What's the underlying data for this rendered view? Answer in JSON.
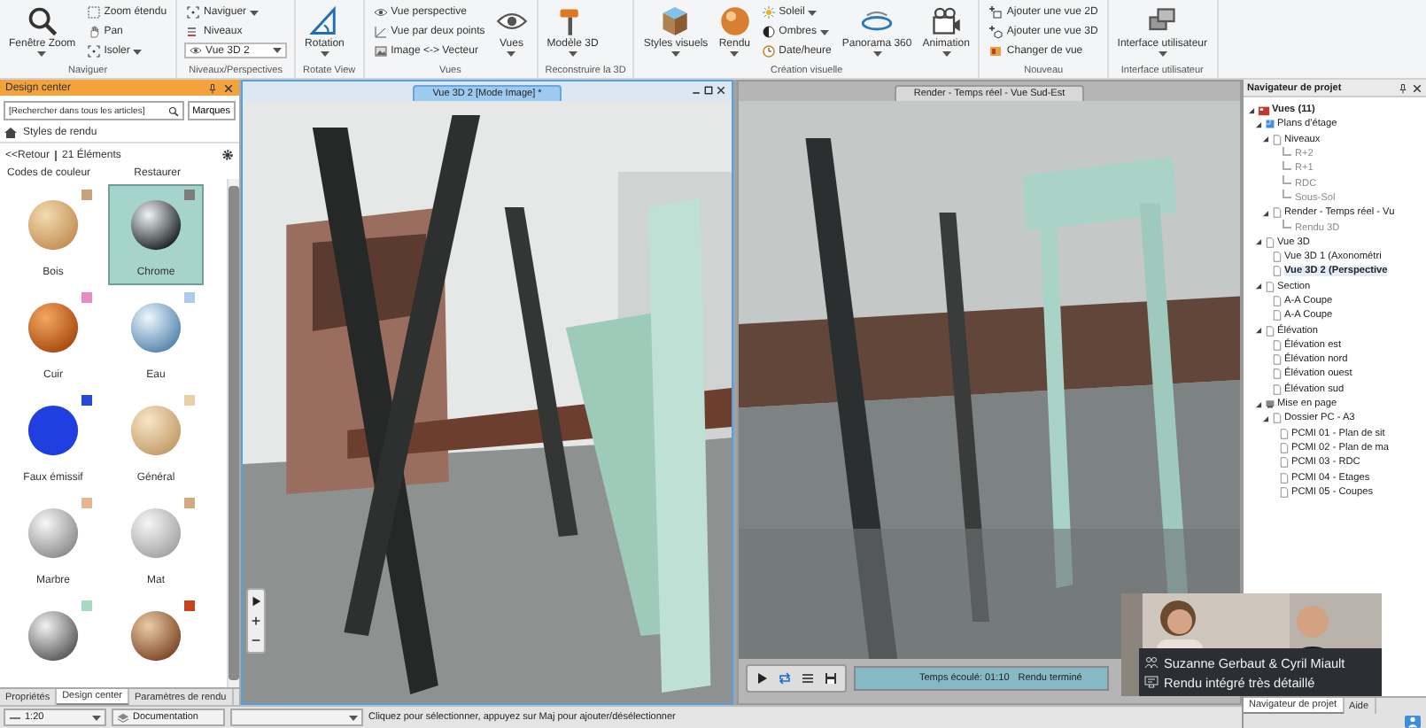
{
  "ribbon": {
    "groups": [
      {
        "label": "Naviguer",
        "columns": [
          {
            "kind": "large",
            "label": "Fenêtre Zoom",
            "dropdown": true
          },
          {
            "kind": "stack",
            "items": [
              {
                "kind": "button",
                "label": "Zoom étendu",
                "dropdown": false
              },
              {
                "kind": "button",
                "label": "Pan",
                "dropdown": false
              },
              {
                "kind": "button",
                "label": "Isoler",
                "dropdown": true
              }
            ]
          }
        ]
      },
      {
        "label": "Niveaux/Perspectives",
        "columns": [
          {
            "kind": "stack",
            "items": [
              {
                "kind": "button",
                "label": "Naviguer",
                "dropdown": true
              },
              {
                "kind": "button",
                "label": "Niveaux",
                "dropdown": false
              },
              {
                "kind": "combo",
                "value": "Vue 3D 2"
              }
            ]
          }
        ]
      },
      {
        "label": "Rotate View",
        "columns": [
          {
            "kind": "large",
            "label": "Rotation",
            "dropdown": true
          }
        ]
      },
      {
        "label": "Vues",
        "columns": [
          {
            "kind": "stack",
            "items": [
              {
                "kind": "button",
                "label": "Vue perspective",
                "dropdown": false
              },
              {
                "kind": "button",
                "label": "Vue par deux points",
                "dropdown": false
              },
              {
                "kind": "button",
                "label": "Image <-> Vecteur",
                "dropdown": false
              }
            ]
          },
          {
            "kind": "large",
            "label": "Vues",
            "dropdown": true
          }
        ]
      },
      {
        "label": "Reconstruire la 3D",
        "columns": [
          {
            "kind": "large",
            "label": "Modèle 3D",
            "dropdown": true
          }
        ]
      },
      {
        "label": "Création visuelle",
        "columns": [
          {
            "kind": "large",
            "label": "Styles visuels",
            "dropdown": true
          },
          {
            "kind": "large",
            "label": "Rendu",
            "dropdown": true
          },
          {
            "kind": "stack",
            "items": [
              {
                "kind": "button",
                "label": "Soleil",
                "dropdown": true
              },
              {
                "kind": "button",
                "label": "Ombres",
                "dropdown": true
              },
              {
                "kind": "button",
                "label": "Date/heure",
                "dropdown": false
              }
            ]
          },
          {
            "kind": "large",
            "label": "Panorama 360",
            "dropdown": true
          },
          {
            "kind": "large",
            "label": "Animation",
            "dropdown": true
          }
        ]
      },
      {
        "label": "Nouveau",
        "columns": [
          {
            "kind": "stack",
            "items": [
              {
                "kind": "button",
                "label": "Ajouter une vue 2D",
                "dropdown": false
              },
              {
                "kind": "button",
                "label": "Ajouter une vue 3D",
                "dropdown": false
              },
              {
                "kind": "button",
                "label": "Changer de vue",
                "dropdown": false
              }
            ]
          }
        ]
      },
      {
        "label": "Interface utilisateur",
        "columns": [
          {
            "kind": "large",
            "label": "Interface utilisateur",
            "dropdown": true
          }
        ]
      }
    ]
  },
  "design_center": {
    "title": "Design center",
    "search": {
      "placeholder": "[Rechercher dans tous les articles]"
    },
    "tags_button": "Marques",
    "breadcrumb": "Styles de rendu",
    "back_link": "<<Retour",
    "count": "21 Éléments",
    "color_codes": "Codes de couleur",
    "restore": "Restaurer",
    "materials": [
      {
        "label": "Bois",
        "kind": "wood",
        "color": "#c9a17a",
        "selected": false
      },
      {
        "label": "Chrome",
        "kind": "chrome",
        "color": "#7d7d7d",
        "selected": true
      },
      {
        "label": "Cuir",
        "kind": "leather",
        "color": "#e58cc4",
        "selected": false
      },
      {
        "label": "Eau",
        "kind": "water",
        "color": "#a9cdea",
        "selected": false
      },
      {
        "label": "Faux émissif",
        "kind": "emissive",
        "color": "#2448d8",
        "selected": false
      },
      {
        "label": "Général",
        "kind": "plain",
        "color": "#e9cfa6",
        "selected": false
      },
      {
        "label": "Marbre",
        "kind": "marble",
        "color": "#e6b78f",
        "selected": false
      },
      {
        "label": "Mat",
        "kind": "matte",
        "color": "#d2aa7c",
        "selected": false
      },
      {
        "kind": "tile",
        "color": "#a6d9c2",
        "selected": false
      },
      {
        "kind": "wood2",
        "color": "#c2471a",
        "selected": false
      }
    ],
    "tabs": [
      {
        "label": "Propriétés",
        "selected": false
      },
      {
        "label": "Design center",
        "selected": true
      },
      {
        "label": "Paramètres de rendu",
        "selected": false
      }
    ]
  },
  "viewports": [
    {
      "title": "Vue 3D 2 [Mode Image] *",
      "active": true,
      "kind": "model"
    },
    {
      "title": "Render - Temps réel - Vue Sud-Est",
      "active": false,
      "kind": "render",
      "progress": {
        "elapsed": "Temps écoulé: 01:10",
        "status": "Rendu terminé",
        "level": 1
      }
    }
  ],
  "project_navigator": {
    "title": "Navigateur de projet",
    "tree": [
      {
        "label": "Vues (11)",
        "kind": "views",
        "expanded": true,
        "selected": false,
        "children": [
          {
            "label": "Plans d'étage",
            "kind": "plans",
            "expanded": true,
            "selected": false,
            "children": [
              {
                "label": "Niveaux",
                "kind": "page",
                "expanded": true,
                "selected": false,
                "children": [
                  {
                    "label": "R+2",
                    "kind": "level",
                    "selected": false
                  },
                  {
                    "label": "R+1",
                    "kind": "level",
                    "selected": false
                  },
                  {
                    "label": "RDC",
                    "kind": "level",
                    "selected": false
                  },
                  {
                    "label": "Sous-Sol",
                    "kind": "level",
                    "selected": false
                  }
                ]
              },
              {
                "label": "Render - Temps réel - Vu",
                "kind": "page",
                "expanded": true,
                "selected": false,
                "children": [
                  {
                    "label": "Rendu 3D",
                    "kind": "level",
                    "selected": false
                  }
                ]
              }
            ]
          },
          {
            "label": "Vue 3D",
            "kind": "page",
            "expanded": true,
            "selected": false,
            "children": [
              {
                "label": "Vue 3D 1 (Axonométri",
                "kind": "page",
                "selected": false
              },
              {
                "label": "Vue 3D 2 (Perspective",
                "kind": "page",
                "selected": true
              }
            ]
          },
          {
            "label": "Section",
            "kind": "page",
            "expanded": true,
            "selected": false,
            "children": [
              {
                "label": "A-A Coupe",
                "kind": "page",
                "selected": false
              },
              {
                "label": "A-A Coupe",
                "kind": "page",
                "selected": false
              }
            ]
          },
          {
            "label": "Élévation",
            "kind": "page",
            "expanded": true,
            "selected": false,
            "children": [
              {
                "label": "Élévation est",
                "kind": "page",
                "selected": false
              },
              {
                "label": "Élévation nord",
                "kind": "page",
                "selected": false
              },
              {
                "label": "Élévation ouest",
                "kind": "page",
                "selected": false
              },
              {
                "label": "Élévation sud",
                "kind": "page",
                "selected": false
              }
            ]
          },
          {
            "label": "Mise en page",
            "kind": "layout",
            "expanded": true,
            "selected": false,
            "children": [
              {
                "label": "Dossier PC - A3",
                "kind": "page",
                "expanded": true,
                "selected": false,
                "children": [
                  {
                    "label": "PCMI 01 - Plan de sit",
                    "kind": "page",
                    "selected": false
                  },
                  {
                    "label": "PCMI 02 - Plan de ma",
                    "kind": "page",
                    "selected": false
                  },
                  {
                    "label": "PCMI 03 - RDC",
                    "kind": "page",
                    "selected": false
                  },
                  {
                    "label": "PCMI 04 - Etages",
                    "kind": "page",
                    "selected": false
                  },
                  {
                    "label": "PCMI 05 - Coupes",
                    "kind": "page",
                    "selected": false
                  }
                ]
              }
            ]
          }
        ]
      }
    ],
    "tabs": [
      {
        "label": "Navigateur de projet",
        "selected": true
      },
      {
        "label": "Aide",
        "selected": false
      }
    ]
  },
  "status_bar": {
    "scale": "1:20",
    "layer": "Documentation",
    "hint": "Cliquez pour sélectionner, appuyez sur Maj pour ajouter/désélectionner"
  },
  "video_overlay": {
    "kind": "picture",
    "names": "Suzanne Gerbaut & Cyril Miault",
    "caption": "Rendu intégré très détaillé"
  }
}
